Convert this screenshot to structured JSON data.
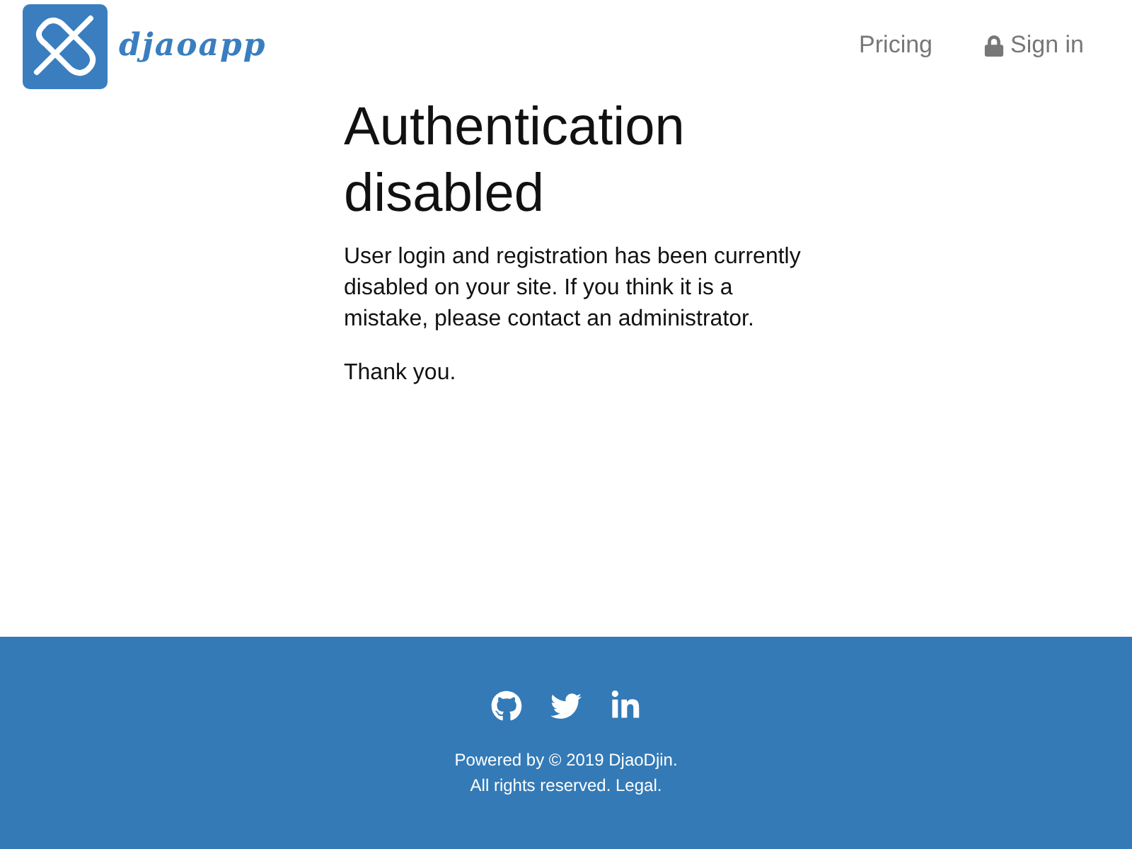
{
  "header": {
    "brand": "djaoapp",
    "nav": [
      {
        "label": "Pricing",
        "kind": "plain"
      },
      {
        "label": "Sign in",
        "kind": "locked"
      }
    ]
  },
  "main": {
    "title": "Authentication disabled",
    "paragraphs": [
      "User login and registration has been currently disabled on your site. If you think it is a mistake, please contact an administrator.",
      "Thank you."
    ]
  },
  "footer": {
    "social": [
      {
        "kind": "github"
      },
      {
        "kind": "twitter"
      },
      {
        "kind": "linkedin"
      }
    ],
    "lines": [
      "Powered by © 2019 DjaoDjin.",
      "All rights reserved. Legal."
    ]
  }
}
